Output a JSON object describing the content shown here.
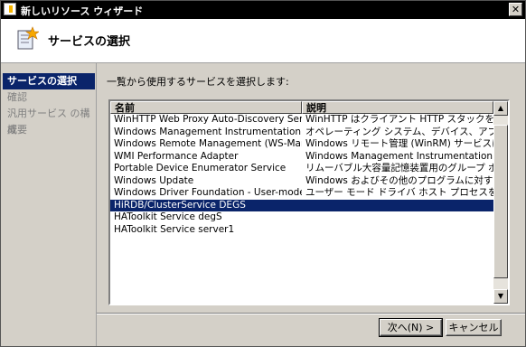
{
  "window": {
    "title": "新しいリソース ウィザード"
  },
  "header": {
    "title": "サービスの選択"
  },
  "sidebar": {
    "items": [
      {
        "label": "サービスの選択",
        "active": true
      },
      {
        "label": "確認",
        "active": false
      },
      {
        "label": "汎用サービス の構成",
        "active": false
      },
      {
        "label": "概要",
        "active": false
      }
    ]
  },
  "main": {
    "description": "一覧から使用するサービスを選択します:",
    "columns": [
      "名前",
      "説明"
    ],
    "rows": [
      {
        "name": "WinHTTP Web Proxy Auto-Discovery Service",
        "desc": "WinHTTP はクライアント HTTP スタックを実装し、..."
      },
      {
        "name": "Windows Management Instrumentation",
        "desc": "オペレーティング システム、デバイス、アプリケーショ..."
      },
      {
        "name": "Windows Remote Management (WS-Managem...",
        "desc": "Windows リモート管理 (WinRM) サービスは、リモ..."
      },
      {
        "name": "WMI Performance Adapter",
        "desc": "Windows Management Instrumentation (WMI) ..."
      },
      {
        "name": "Portable Device Enumerator Service",
        "desc": "リムーバブル大容量記憶装置用のグループ ポリシ..."
      },
      {
        "name": "Windows Update",
        "desc": "Windows およびその他のプログラムに対する更新..."
      },
      {
        "name": "Windows Driver Foundation - User-mode Driv...",
        "desc": "ユーザー モード ドライバ ホスト プロセスを管理し..."
      },
      {
        "name": "HiRDB/ClusterService DEGS",
        "desc": "",
        "selected": true
      },
      {
        "name": "HAToolkit Service degS",
        "desc": ""
      },
      {
        "name": "HAToolkit Service server1",
        "desc": ""
      }
    ]
  },
  "buttons": {
    "next": "次へ(N) >",
    "cancel": "キャンセル"
  },
  "icons": {
    "app": "wizard-app-icon",
    "header": "wizard-document-icon",
    "close": "close-icon"
  },
  "colors": {
    "selection": "#0a246a",
    "titlebar": "#000000",
    "chrome": "#d4d0c8"
  }
}
